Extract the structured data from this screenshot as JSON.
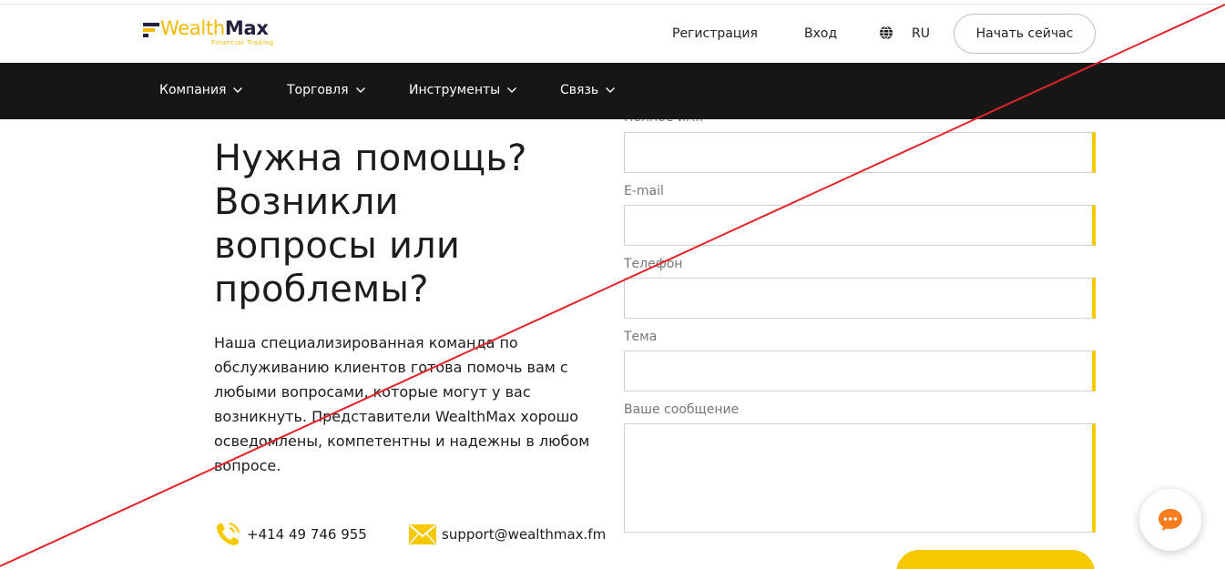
{
  "header": {
    "logo": {
      "brand_part1": "Wealth",
      "brand_part2": "Max",
      "tagline": "Financial Trading"
    },
    "register_label": "Регистрация",
    "login_label": "Вход",
    "language": "RU",
    "cta_label": "Начать сейчас"
  },
  "nav": {
    "items": [
      {
        "label": "Компания"
      },
      {
        "label": "Торговля"
      },
      {
        "label": "Инструменты"
      },
      {
        "label": "Связь"
      }
    ]
  },
  "main": {
    "headline_lines": [
      "Нужна помощь?",
      "Возникли",
      "вопросы или",
      "проблемы?"
    ],
    "description": "Наша специализированная команда по обслуживанию клиентов готова помочь вам с любыми вопросами, которые могут у вас возникнуть. Представители WealthMax хорошо осведомлены, компетентны и надежны в любом вопросе.",
    "phone": "+414 49 746 955",
    "email": "support@wealthmax.fm"
  },
  "form": {
    "full_name_label": "Полное имя",
    "email_label": "E-mail",
    "phone_label": "Телефон",
    "subject_label": "Тема",
    "message_label": "Ваше сообщение"
  },
  "colors": {
    "accent": "#f6c800",
    "navbar": "#161616",
    "strike_line": "#e3242b",
    "chat_icon": "#f57c1f"
  },
  "icons": {
    "globe": "globe-icon",
    "phone": "phone-icon",
    "email": "envelope-icon",
    "chat": "chat-icon"
  }
}
